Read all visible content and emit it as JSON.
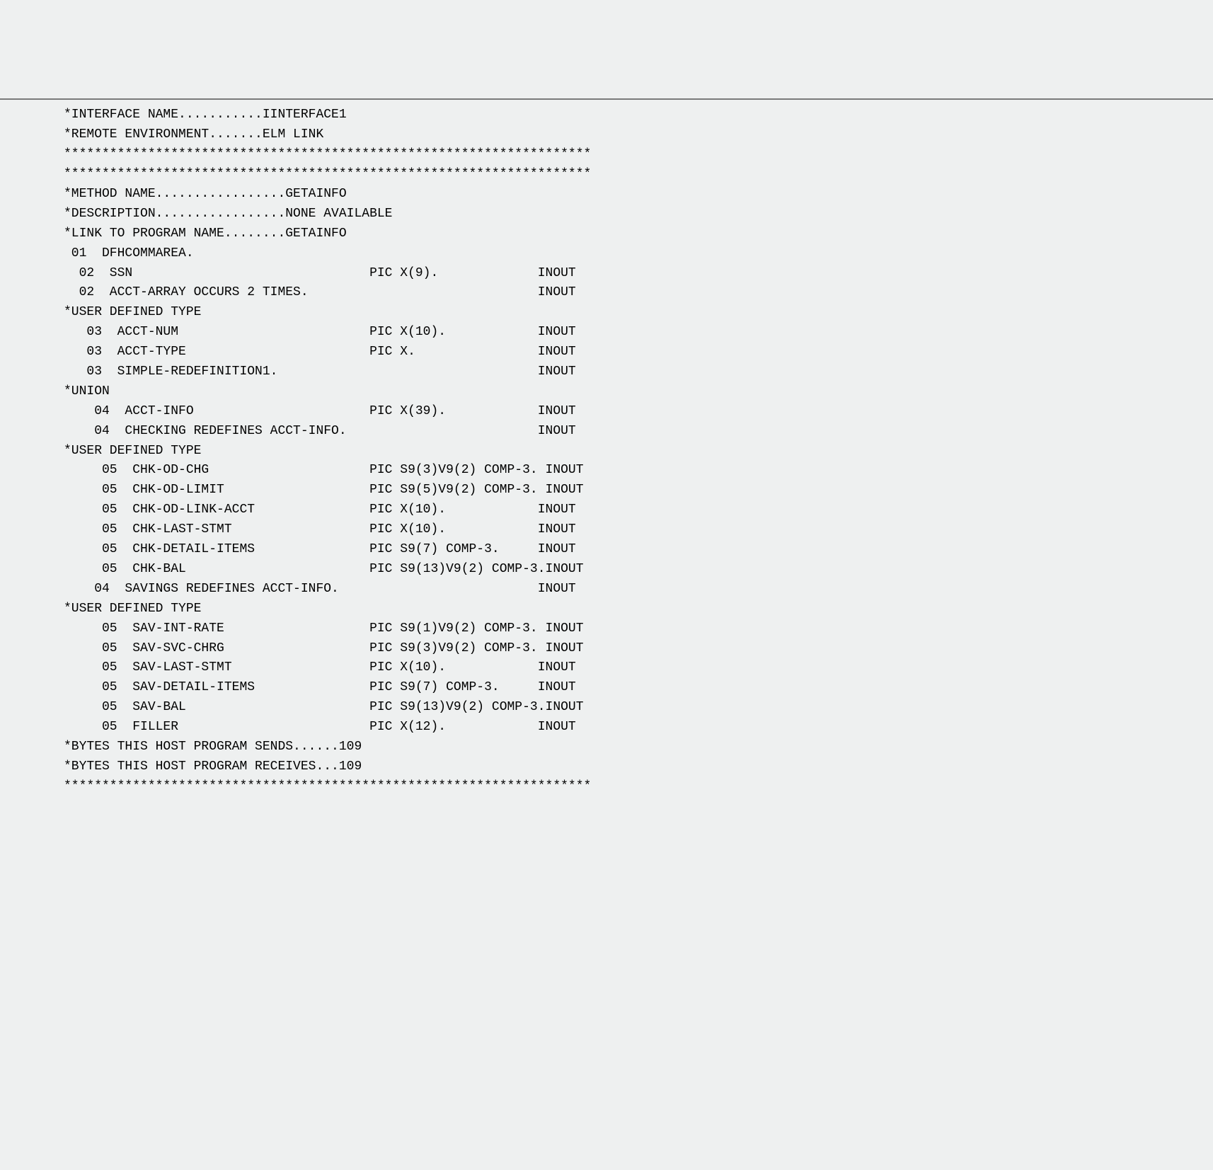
{
  "lines": [
    "*INTERFACE NAME...........IINTERFACE1",
    "*REMOTE ENVIRONMENT.......ELM LINK",
    "*********************************************************************",
    "",
    "",
    "*********************************************************************",
    "*METHOD NAME.................GETAINFO",
    "*DESCRIPTION.................NONE AVAILABLE",
    "*LINK TO PROGRAM NAME........GETAINFO",
    "",
    " 01  DFHCOMMAREA.",
    "  02  SSN                               PIC X(9).             INOUT",
    "  02  ACCT-ARRAY OCCURS 2 TIMES.                              INOUT",
    "*USER DEFINED TYPE",
    "   03  ACCT-NUM                         PIC X(10).            INOUT",
    "   03  ACCT-TYPE                        PIC X.                INOUT",
    "   03  SIMPLE-REDEFINITION1.                                  INOUT",
    "*UNION",
    "    04  ACCT-INFO                       PIC X(39).            INOUT",
    "    04  CHECKING REDEFINES ACCT-INFO.                         INOUT",
    "*USER DEFINED TYPE",
    "     05  CHK-OD-CHG                     PIC S9(3)V9(2) COMP-3. INOUT",
    "     05  CHK-OD-LIMIT                   PIC S9(5)V9(2) COMP-3. INOUT",
    "     05  CHK-OD-LINK-ACCT               PIC X(10).            INOUT",
    "     05  CHK-LAST-STMT                  PIC X(10).            INOUT",
    "     05  CHK-DETAIL-ITEMS               PIC S9(7) COMP-3.     INOUT",
    "     05  CHK-BAL                        PIC S9(13)V9(2) COMP-3.INOUT",
    "    04  SAVINGS REDEFINES ACCT-INFO.                          INOUT",
    "*USER DEFINED TYPE",
    "     05  SAV-INT-RATE                   PIC S9(1)V9(2) COMP-3. INOUT",
    "     05  SAV-SVC-CHRG                   PIC S9(3)V9(2) COMP-3. INOUT",
    "     05  SAV-LAST-STMT                  PIC X(10).            INOUT",
    "     05  SAV-DETAIL-ITEMS               PIC S9(7) COMP-3.     INOUT",
    "     05  SAV-BAL                        PIC S9(13)V9(2) COMP-3.INOUT",
    "     05  FILLER                         PIC X(12).            INOUT",
    "",
    "*BYTES THIS HOST PROGRAM SENDS......109",
    "*BYTES THIS HOST PROGRAM RECEIVES...109",
    "*********************************************************************"
  ]
}
